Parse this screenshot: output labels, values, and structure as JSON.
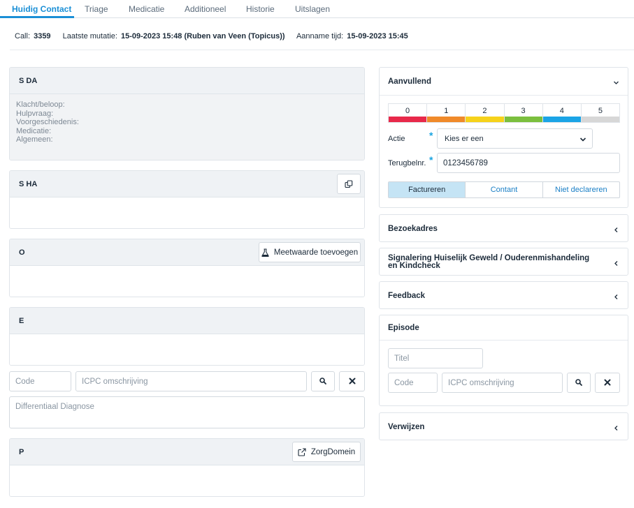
{
  "tabs": [
    "Huidig Contact",
    "Triage",
    "Medicatie",
    "Additioneel",
    "Historie",
    "Uitslagen"
  ],
  "info": {
    "call_label": "Call:",
    "call_value": "3359",
    "mutatie_label": "Laatste mutatie:",
    "mutatie_value": "15-09-2023 15:48 (Ruben van Veen (Topicus))",
    "aanname_label": "Aanname tijd:",
    "aanname_value": "15-09-2023 15:45"
  },
  "sda": {
    "title": "S DA",
    "lines": [
      "Klacht/beloop:",
      "Hulpvraag:",
      "Voorgeschiedenis:",
      "Medicatie:",
      "Algemeen:"
    ]
  },
  "sha": {
    "title": "S HA",
    "copy_icon": "copy-icon"
  },
  "o": {
    "title": "O",
    "button": "Meetwaarde toevoegen",
    "icon": "flask-icon"
  },
  "e": {
    "title": "E"
  },
  "diagnosis": {
    "code_placeholder": "Code",
    "icpc_placeholder": "ICPC omschrijving",
    "differential_placeholder": "Differentiaal Diagnose"
  },
  "p": {
    "title": "P",
    "button": "ZorgDomein",
    "icon": "external-link-icon"
  },
  "aanvullend": {
    "title": "Aanvullend",
    "scale": [
      {
        "label": "0",
        "color": "#e8294a"
      },
      {
        "label": "1",
        "color": "#f08a2a"
      },
      {
        "label": "2",
        "color": "#f6d21b"
      },
      {
        "label": "3",
        "color": "#7bbf3e"
      },
      {
        "label": "4",
        "color": "#1ba4e6"
      },
      {
        "label": "5",
        "color": "#d7d7d7"
      }
    ],
    "actie_label": "Actie",
    "actie_value": "Kies er een",
    "terugbel_label": "Terugbelnr.",
    "terugbel_value": "0123456789",
    "billing": [
      "Factureren",
      "Contant",
      "Niet declareren"
    ],
    "billing_active": "Factureren"
  },
  "sections": {
    "bezoekadres": "Bezoekadres",
    "signalering": "Signalering Huiselijk Geweld / Ouderenmishandeling en Kindcheck",
    "feedback": "Feedback",
    "episode": "Episode",
    "verwijzen": "Verwijzen"
  },
  "episode": {
    "titel_placeholder": "Titel",
    "code_placeholder": "Code",
    "icpc_placeholder": "ICPC omschrijving"
  },
  "colors": {
    "accent": "#1a8fd6",
    "active_segment": "#c5e4f5",
    "required": "#1aa3e0"
  }
}
